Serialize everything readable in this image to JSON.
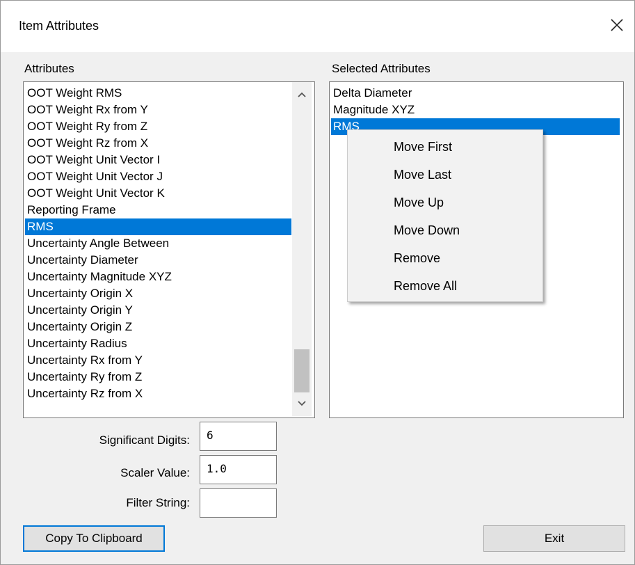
{
  "window": {
    "title": "Item Attributes",
    "close_icon": "close-icon"
  },
  "attributes": {
    "label": "Attributes",
    "items": [
      "OOT Weight RMS",
      "OOT Weight Rx from Y",
      "OOT Weight Ry from Z",
      "OOT Weight Rz from X",
      "OOT Weight Unit Vector I",
      "OOT Weight Unit Vector J",
      "OOT Weight Unit Vector K",
      "Reporting Frame",
      "RMS",
      "Uncertainty Angle Between",
      "Uncertainty Diameter",
      "Uncertainty Magnitude XYZ",
      "Uncertainty Origin X",
      "Uncertainty Origin Y",
      "Uncertainty Origin Z",
      "Uncertainty Radius",
      "Uncertainty Rx from Y",
      "Uncertainty Ry from Z",
      "Uncertainty Rz from X"
    ],
    "selected_index": 8,
    "scroll_up_icon": "chevron-up-icon",
    "scroll_down_icon": "chevron-down-icon"
  },
  "selected_attributes": {
    "label": "Selected Attributes",
    "items": [
      "Delta Diameter",
      "Magnitude XYZ",
      "RMS"
    ],
    "selected_index": 2
  },
  "context_menu": {
    "items": [
      "Move First",
      "Move Last",
      "Move Up",
      "Move Down",
      "Remove",
      "Remove All"
    ]
  },
  "fields": {
    "significant_digits": {
      "label": "Significant Digits:",
      "value": "6"
    },
    "scaler_value": {
      "label": "Scaler Value:",
      "value": "1.0"
    },
    "filter_string": {
      "label": "Filter String:",
      "value": ""
    }
  },
  "buttons": {
    "copy": "Copy To Clipboard",
    "exit": "Exit"
  },
  "colors": {
    "selection": "#0078d7",
    "dialog_bg": "#f0f0f0"
  }
}
